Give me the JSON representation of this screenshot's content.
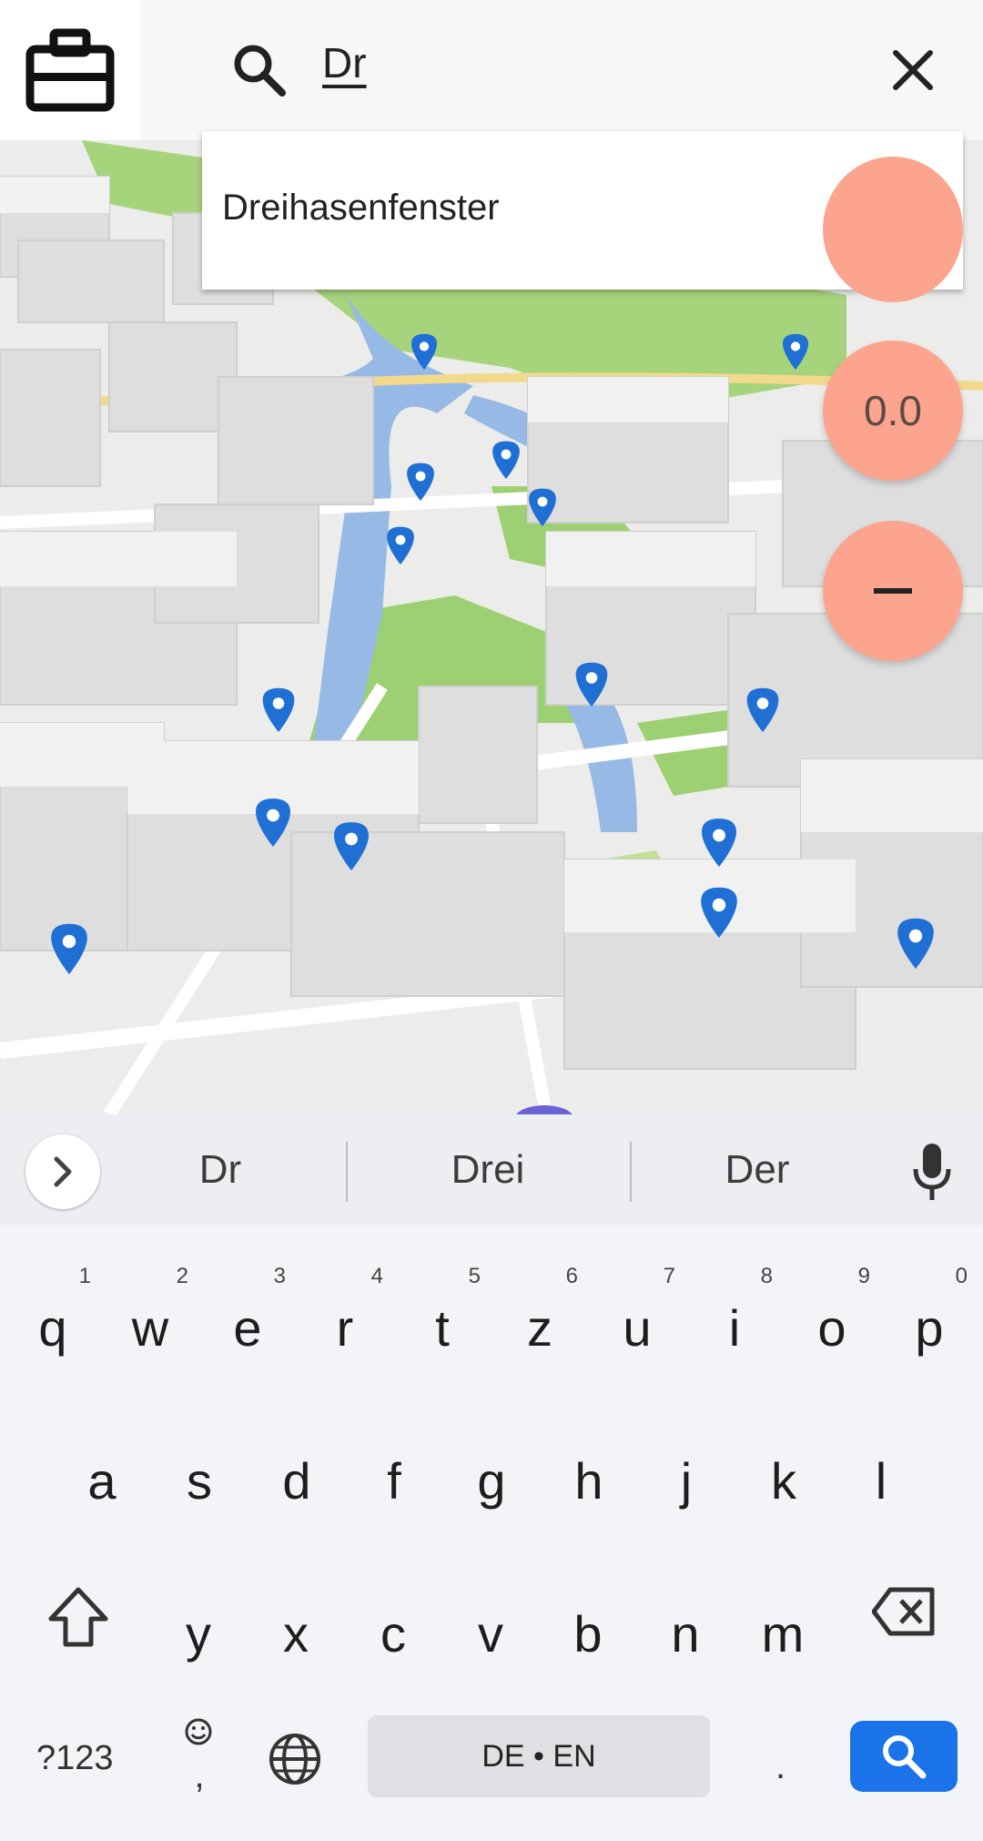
{
  "top_bar": {
    "search_query": "Dr",
    "left_icon": "briefcase-icon",
    "search_icon": "search-icon",
    "close_icon": "close-icon"
  },
  "suggestions_dropdown": {
    "items": [
      "Dreihasenfenster"
    ]
  },
  "map": {
    "marker_icon": "map-pin-icon",
    "colors": {
      "park": "#9dd072",
      "water": "#97b9e5",
      "building": "#dcdcdc",
      "pin": "#1f6fd4"
    }
  },
  "controls": {
    "value_display": "0.0",
    "zoom_out_icon": "minus-icon",
    "fab_color": "#fca48d"
  },
  "keyboard": {
    "suggestions": [
      "Dr",
      "Drei",
      "Der"
    ],
    "row1": [
      {
        "l": "q",
        "n": "1"
      },
      {
        "l": "w",
        "n": "2"
      },
      {
        "l": "e",
        "n": "3"
      },
      {
        "l": "r",
        "n": "4"
      },
      {
        "l": "t",
        "n": "5"
      },
      {
        "l": "z",
        "n": "6"
      },
      {
        "l": "u",
        "n": "7"
      },
      {
        "l": "i",
        "n": "8"
      },
      {
        "l": "o",
        "n": "9"
      },
      {
        "l": "p",
        "n": "0"
      }
    ],
    "row2": [
      "a",
      "s",
      "d",
      "f",
      "g",
      "h",
      "j",
      "k",
      "l"
    ],
    "row3": [
      "y",
      "x",
      "c",
      "v",
      "b",
      "n",
      "m"
    ],
    "symbols_key": "?123",
    "comma_key": ",",
    "space_label": "DE • EN",
    "period_key": ".",
    "action_color": "#1a73e8"
  }
}
